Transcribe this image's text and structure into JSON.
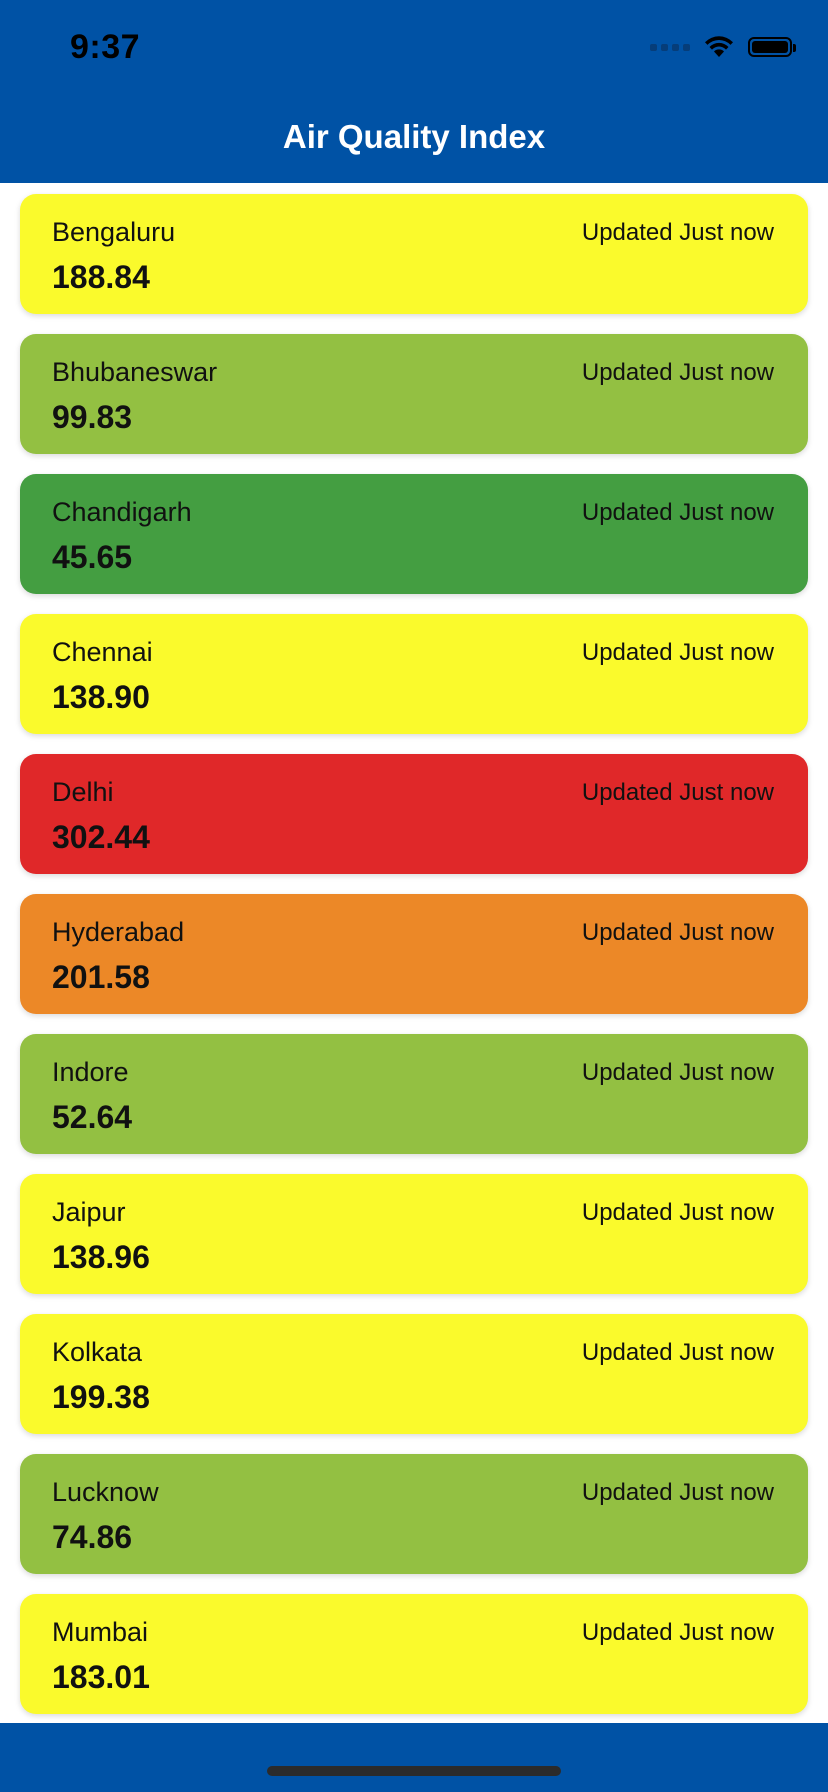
{
  "status_bar": {
    "time": "9:37"
  },
  "nav": {
    "title": "Air Quality Index"
  },
  "colors": {
    "header_bg": "#0052a5",
    "satisfactory": "#fafa2c",
    "good_light": "#93c042",
    "good": "#449e41",
    "poor": "#e02829",
    "moderate": "#ec8827"
  },
  "cities": [
    {
      "name": "Bengaluru",
      "aqi": "188.84",
      "updated": "Updated Just now",
      "color": "#fafa2c"
    },
    {
      "name": "Bhubaneswar",
      "aqi": "99.83",
      "updated": "Updated Just now",
      "color": "#93c042"
    },
    {
      "name": "Chandigarh",
      "aqi": "45.65",
      "updated": "Updated Just now",
      "color": "#449e41"
    },
    {
      "name": "Chennai",
      "aqi": "138.90",
      "updated": "Updated Just now",
      "color": "#fafa2c"
    },
    {
      "name": "Delhi",
      "aqi": "302.44",
      "updated": "Updated Just now",
      "color": "#e02829"
    },
    {
      "name": "Hyderabad",
      "aqi": "201.58",
      "updated": "Updated Just now",
      "color": "#ec8827"
    },
    {
      "name": "Indore",
      "aqi": "52.64",
      "updated": "Updated Just now",
      "color": "#93c042"
    },
    {
      "name": "Jaipur",
      "aqi": "138.96",
      "updated": "Updated Just now",
      "color": "#fafa2c"
    },
    {
      "name": "Kolkata",
      "aqi": "199.38",
      "updated": "Updated Just now",
      "color": "#fafa2c"
    },
    {
      "name": "Lucknow",
      "aqi": "74.86",
      "updated": "Updated Just now",
      "color": "#93c042"
    },
    {
      "name": "Mumbai",
      "aqi": "183.01",
      "updated": "Updated Just now",
      "color": "#fafa2c"
    }
  ]
}
